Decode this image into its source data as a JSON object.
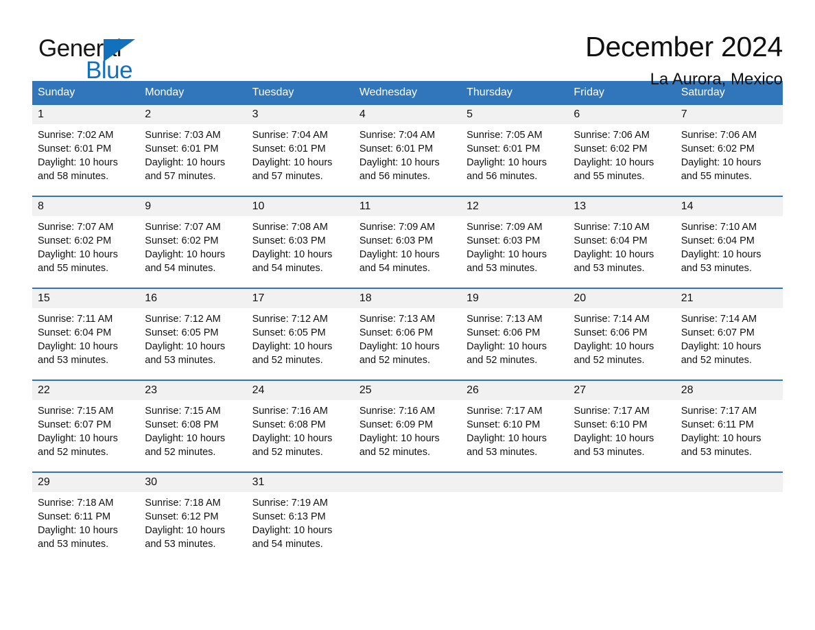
{
  "brand": {
    "name_part1": "General",
    "name_part2": "Blue",
    "triangle_icon": "triangle-logo-icon",
    "accent_color": "#1271bd"
  },
  "header": {
    "title": "December 2024",
    "location": "La Aurora, Mexico"
  },
  "theme": {
    "header_blue": "#3176bb",
    "row_rule_blue": "#2f74ba",
    "date_band_gray": "#f1f1f1",
    "text_color": "#111111"
  },
  "weekdays": [
    "Sunday",
    "Monday",
    "Tuesday",
    "Wednesday",
    "Thursday",
    "Friday",
    "Saturday"
  ],
  "weeks": [
    {
      "days": [
        {
          "date": "1",
          "sunrise": "Sunrise: 7:02 AM",
          "sunset": "Sunset: 6:01 PM",
          "daylight_line1": "Daylight: 10 hours",
          "daylight_line2": "and 58 minutes."
        },
        {
          "date": "2",
          "sunrise": "Sunrise: 7:03 AM",
          "sunset": "Sunset: 6:01 PM",
          "daylight_line1": "Daylight: 10 hours",
          "daylight_line2": "and 57 minutes."
        },
        {
          "date": "3",
          "sunrise": "Sunrise: 7:04 AM",
          "sunset": "Sunset: 6:01 PM",
          "daylight_line1": "Daylight: 10 hours",
          "daylight_line2": "and 57 minutes."
        },
        {
          "date": "4",
          "sunrise": "Sunrise: 7:04 AM",
          "sunset": "Sunset: 6:01 PM",
          "daylight_line1": "Daylight: 10 hours",
          "daylight_line2": "and 56 minutes."
        },
        {
          "date": "5",
          "sunrise": "Sunrise: 7:05 AM",
          "sunset": "Sunset: 6:01 PM",
          "daylight_line1": "Daylight: 10 hours",
          "daylight_line2": "and 56 minutes."
        },
        {
          "date": "6",
          "sunrise": "Sunrise: 7:06 AM",
          "sunset": "Sunset: 6:02 PM",
          "daylight_line1": "Daylight: 10 hours",
          "daylight_line2": "and 55 minutes."
        },
        {
          "date": "7",
          "sunrise": "Sunrise: 7:06 AM",
          "sunset": "Sunset: 6:02 PM",
          "daylight_line1": "Daylight: 10 hours",
          "daylight_line2": "and 55 minutes."
        }
      ]
    },
    {
      "days": [
        {
          "date": "8",
          "sunrise": "Sunrise: 7:07 AM",
          "sunset": "Sunset: 6:02 PM",
          "daylight_line1": "Daylight: 10 hours",
          "daylight_line2": "and 55 minutes."
        },
        {
          "date": "9",
          "sunrise": "Sunrise: 7:07 AM",
          "sunset": "Sunset: 6:02 PM",
          "daylight_line1": "Daylight: 10 hours",
          "daylight_line2": "and 54 minutes."
        },
        {
          "date": "10",
          "sunrise": "Sunrise: 7:08 AM",
          "sunset": "Sunset: 6:03 PM",
          "daylight_line1": "Daylight: 10 hours",
          "daylight_line2": "and 54 minutes."
        },
        {
          "date": "11",
          "sunrise": "Sunrise: 7:09 AM",
          "sunset": "Sunset: 6:03 PM",
          "daylight_line1": "Daylight: 10 hours",
          "daylight_line2": "and 54 minutes."
        },
        {
          "date": "12",
          "sunrise": "Sunrise: 7:09 AM",
          "sunset": "Sunset: 6:03 PM",
          "daylight_line1": "Daylight: 10 hours",
          "daylight_line2": "and 53 minutes."
        },
        {
          "date": "13",
          "sunrise": "Sunrise: 7:10 AM",
          "sunset": "Sunset: 6:04 PM",
          "daylight_line1": "Daylight: 10 hours",
          "daylight_line2": "and 53 minutes."
        },
        {
          "date": "14",
          "sunrise": "Sunrise: 7:10 AM",
          "sunset": "Sunset: 6:04 PM",
          "daylight_line1": "Daylight: 10 hours",
          "daylight_line2": "and 53 minutes."
        }
      ]
    },
    {
      "days": [
        {
          "date": "15",
          "sunrise": "Sunrise: 7:11 AM",
          "sunset": "Sunset: 6:04 PM",
          "daylight_line1": "Daylight: 10 hours",
          "daylight_line2": "and 53 minutes."
        },
        {
          "date": "16",
          "sunrise": "Sunrise: 7:12 AM",
          "sunset": "Sunset: 6:05 PM",
          "daylight_line1": "Daylight: 10 hours",
          "daylight_line2": "and 53 minutes."
        },
        {
          "date": "17",
          "sunrise": "Sunrise: 7:12 AM",
          "sunset": "Sunset: 6:05 PM",
          "daylight_line1": "Daylight: 10 hours",
          "daylight_line2": "and 52 minutes."
        },
        {
          "date": "18",
          "sunrise": "Sunrise: 7:13 AM",
          "sunset": "Sunset: 6:06 PM",
          "daylight_line1": "Daylight: 10 hours",
          "daylight_line2": "and 52 minutes."
        },
        {
          "date": "19",
          "sunrise": "Sunrise: 7:13 AM",
          "sunset": "Sunset: 6:06 PM",
          "daylight_line1": "Daylight: 10 hours",
          "daylight_line2": "and 52 minutes."
        },
        {
          "date": "20",
          "sunrise": "Sunrise: 7:14 AM",
          "sunset": "Sunset: 6:06 PM",
          "daylight_line1": "Daylight: 10 hours",
          "daylight_line2": "and 52 minutes."
        },
        {
          "date": "21",
          "sunrise": "Sunrise: 7:14 AM",
          "sunset": "Sunset: 6:07 PM",
          "daylight_line1": "Daylight: 10 hours",
          "daylight_line2": "and 52 minutes."
        }
      ]
    },
    {
      "days": [
        {
          "date": "22",
          "sunrise": "Sunrise: 7:15 AM",
          "sunset": "Sunset: 6:07 PM",
          "daylight_line1": "Daylight: 10 hours",
          "daylight_line2": "and 52 minutes."
        },
        {
          "date": "23",
          "sunrise": "Sunrise: 7:15 AM",
          "sunset": "Sunset: 6:08 PM",
          "daylight_line1": "Daylight: 10 hours",
          "daylight_line2": "and 52 minutes."
        },
        {
          "date": "24",
          "sunrise": "Sunrise: 7:16 AM",
          "sunset": "Sunset: 6:08 PM",
          "daylight_line1": "Daylight: 10 hours",
          "daylight_line2": "and 52 minutes."
        },
        {
          "date": "25",
          "sunrise": "Sunrise: 7:16 AM",
          "sunset": "Sunset: 6:09 PM",
          "daylight_line1": "Daylight: 10 hours",
          "daylight_line2": "and 52 minutes."
        },
        {
          "date": "26",
          "sunrise": "Sunrise: 7:17 AM",
          "sunset": "Sunset: 6:10 PM",
          "daylight_line1": "Daylight: 10 hours",
          "daylight_line2": "and 53 minutes."
        },
        {
          "date": "27",
          "sunrise": "Sunrise: 7:17 AM",
          "sunset": "Sunset: 6:10 PM",
          "daylight_line1": "Daylight: 10 hours",
          "daylight_line2": "and 53 minutes."
        },
        {
          "date": "28",
          "sunrise": "Sunrise: 7:17 AM",
          "sunset": "Sunset: 6:11 PM",
          "daylight_line1": "Daylight: 10 hours",
          "daylight_line2": "and 53 minutes."
        }
      ]
    },
    {
      "days": [
        {
          "date": "29",
          "sunrise": "Sunrise: 7:18 AM",
          "sunset": "Sunset: 6:11 PM",
          "daylight_line1": "Daylight: 10 hours",
          "daylight_line2": "and 53 minutes."
        },
        {
          "date": "30",
          "sunrise": "Sunrise: 7:18 AM",
          "sunset": "Sunset: 6:12 PM",
          "daylight_line1": "Daylight: 10 hours",
          "daylight_line2": "and 53 minutes."
        },
        {
          "date": "31",
          "sunrise": "Sunrise: 7:19 AM",
          "sunset": "Sunset: 6:13 PM",
          "daylight_line1": "Daylight: 10 hours",
          "daylight_line2": "and 54 minutes."
        },
        {
          "date": "",
          "sunrise": "",
          "sunset": "",
          "daylight_line1": "",
          "daylight_line2": ""
        },
        {
          "date": "",
          "sunrise": "",
          "sunset": "",
          "daylight_line1": "",
          "daylight_line2": ""
        },
        {
          "date": "",
          "sunrise": "",
          "sunset": "",
          "daylight_line1": "",
          "daylight_line2": ""
        },
        {
          "date": "",
          "sunrise": "",
          "sunset": "",
          "daylight_line1": "",
          "daylight_line2": ""
        }
      ]
    }
  ]
}
